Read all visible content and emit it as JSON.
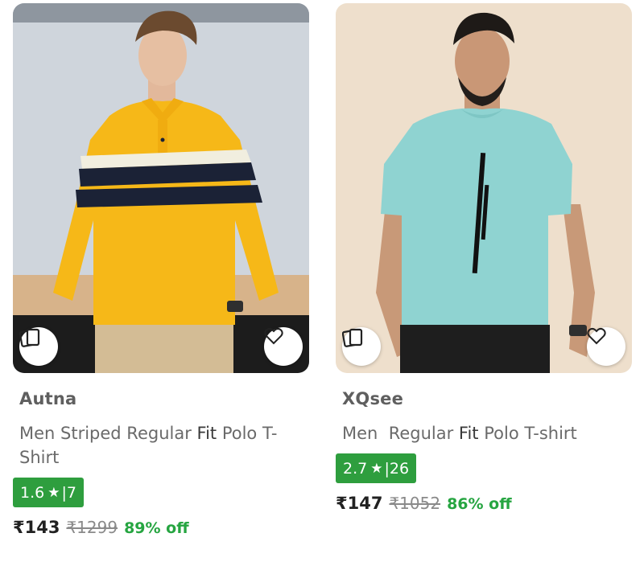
{
  "products": [
    {
      "brand": "Autna",
      "title_before": "Men Striped Regular ",
      "title_fit": "Fit",
      "title_after": " Polo T-Shirt",
      "rating": "1.6",
      "rating_count": "7",
      "price": "₹143",
      "mrp": "₹1299",
      "discount": "89% off",
      "icons": [
        "similar-products-icon",
        "heart-icon"
      ],
      "colors": {
        "shirt": "#f6b818",
        "stripe_dark": "#1b2236",
        "stripe_light": "#f1eedf",
        "pants": "#d3bc95"
      }
    },
    {
      "brand": "XQsee",
      "title_before": "Men  Regular ",
      "title_fit": "Fit",
      "title_after": " Polo T-shirt",
      "rating": "2.7",
      "rating_count": "26",
      "price": "₹147",
      "mrp": "₹1052",
      "discount": "86% off",
      "icons": [
        "similar-products-icon",
        "heart-icon"
      ],
      "colors": {
        "shirt": "#8fd3d1",
        "background": "#eedfcc",
        "pants": "#1e1e1e"
      }
    }
  ],
  "colors": {
    "rating_badge": "#2e9e3e",
    "discount": "#26a541"
  }
}
